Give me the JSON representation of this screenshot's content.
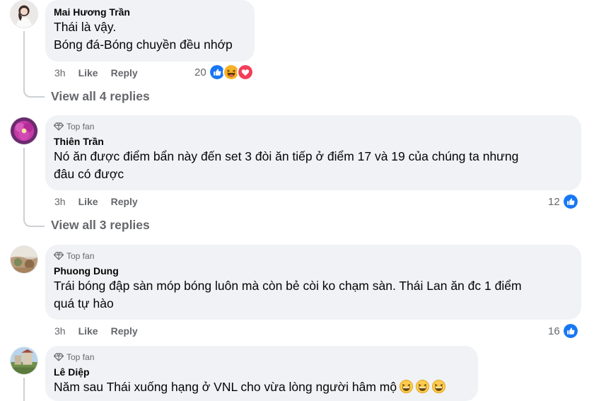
{
  "comments": [
    {
      "author": "Mai Hương Trần",
      "top_fan": false,
      "lines": [
        "Thái là vậy.",
        "Bóng đá-Bóng chuyền đều nhớp"
      ],
      "time": "3h",
      "like_label": "Like",
      "reply_label": "Reply",
      "reaction_count": "20",
      "reactions": [
        "like-icon",
        "haha-icon",
        "love-icon"
      ],
      "view_replies": "View all 4 replies"
    },
    {
      "author": "Thiên Trần",
      "top_fan": true,
      "badge": "Top fan",
      "lines": [
        "Nó ăn được điểm bẩn này đến set 3 đòi ăn tiếp ở điểm 17 và 19 của chúng ta nhưng",
        "đâu có được"
      ],
      "time": "3h",
      "like_label": "Like",
      "reply_label": "Reply",
      "reaction_count": "12",
      "reactions": [
        "like-icon"
      ],
      "view_replies": "View all 3 replies"
    },
    {
      "author": "Phuong Dung",
      "top_fan": true,
      "badge": "Top fan",
      "lines": [
        "Trái bóng đập sàn móp bóng luôn mà còn bẻ còi ko chạm sàn. Thái Lan ăn đc 1 điểm",
        "quá tự hào"
      ],
      "time": "3h",
      "like_label": "Like",
      "reply_label": "Reply",
      "reaction_count": "16",
      "reactions": [
        "like-icon"
      ]
    },
    {
      "author": "Lê Diệp",
      "top_fan": true,
      "badge": "Top fan",
      "lines": [
        "Năm sau Thái xuống hạng ở VNL cho vừa lòng người hâm mộ"
      ],
      "trailing_emojis": [
        "laughing-emoji",
        "laughing-emoji",
        "laughing-emoji"
      ]
    }
  ],
  "colors": {
    "bubble": "#f0f2f5",
    "secondary_text": "#65676b",
    "like_blue": "#1877f2",
    "love_red": "#f33e58",
    "haha_yellow": "#f7b125"
  }
}
